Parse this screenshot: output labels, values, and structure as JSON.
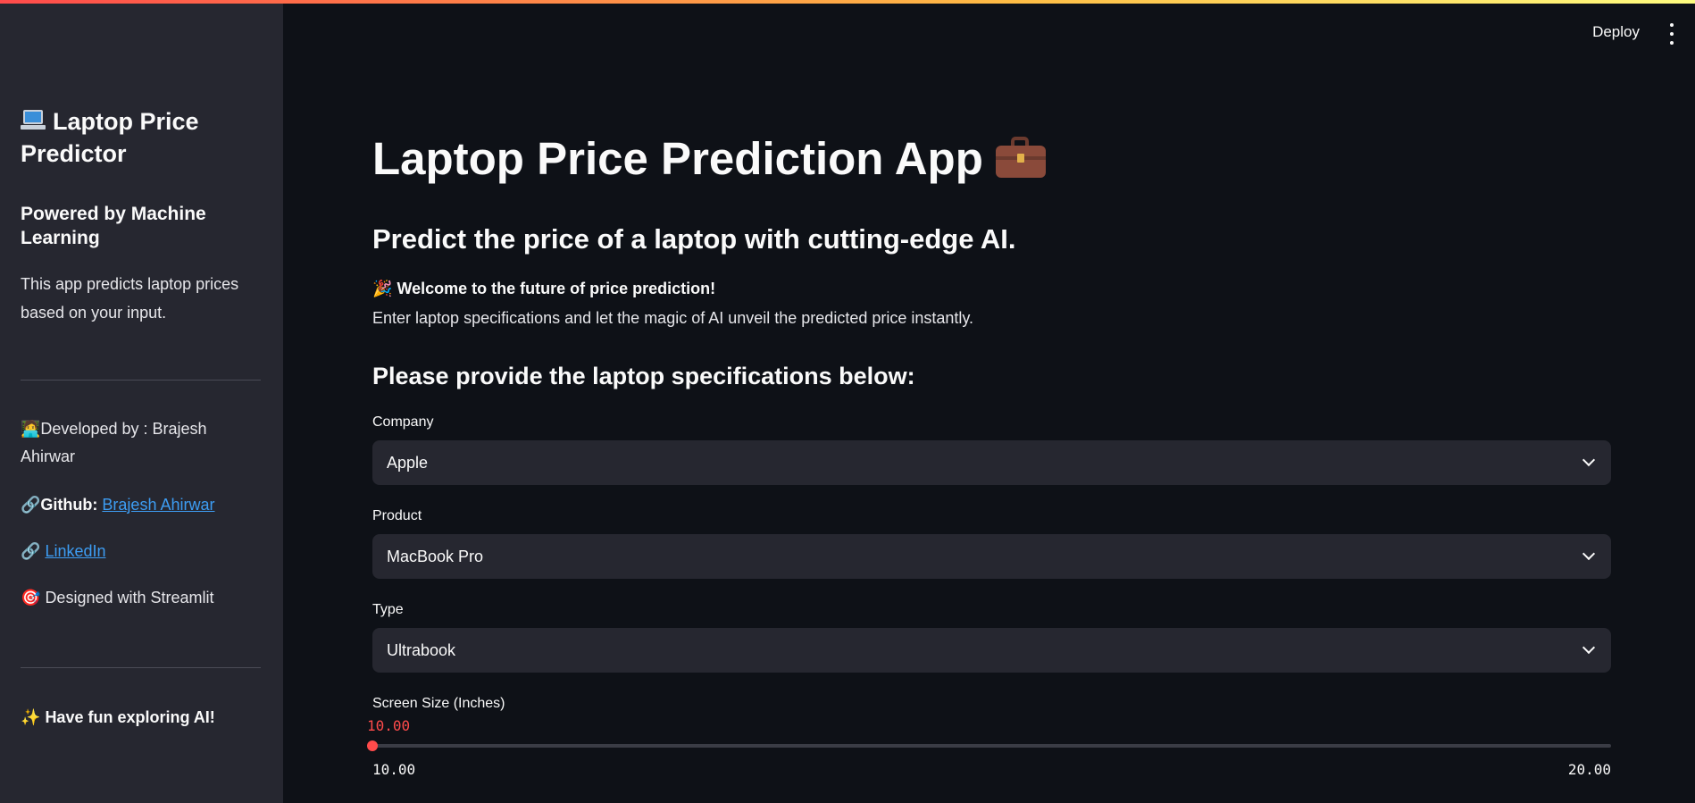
{
  "sidebar": {
    "title": "Laptop Price Predictor",
    "subtitle": "Powered by Machine Learning",
    "description": "This app predicts laptop prices based on your input.",
    "developer_prefix": "🧑‍💻",
    "developer_text": "Developed by : Brajesh Ahirwar",
    "github_prefix": "🔗",
    "github_label": "Github:",
    "github_link": "Brajesh Ahirwar",
    "linkedin_prefix": "🔗",
    "linkedin_link": "LinkedIn",
    "designed_prefix": "🎯",
    "designed_text": "Designed with Streamlit",
    "fun_prefix": "✨",
    "fun_text": "Have fun exploring AI!"
  },
  "header": {
    "deploy_label": "Deploy"
  },
  "main": {
    "title": "Laptop Price Prediction App",
    "subtitle": "Predict the price of a laptop with cutting-edge AI.",
    "welcome_prefix": "🎉",
    "welcome_text": "Welcome to the future of price prediction!",
    "enter_text": "Enter laptop specifications and let the magic of AI unveil the predicted price instantly.",
    "form_heading": "Please provide the laptop specifications below:",
    "fields": {
      "company": {
        "label": "Company",
        "value": "Apple"
      },
      "product": {
        "label": "Product",
        "value": "MacBook Pro"
      },
      "type": {
        "label": "Type",
        "value": "Ultrabook"
      },
      "screen_size": {
        "label": "Screen Size (Inches)",
        "value": "10.00",
        "min": "10.00",
        "max": "20.00",
        "fraction": 0.0
      }
    }
  },
  "colors": {
    "accent": "#ff4b4b",
    "link": "#3d9df3",
    "sidebar_bg": "#262730",
    "main_bg": "#0e1117"
  },
  "icons": [
    "laptop-icon",
    "briefcase-icon",
    "party-popper-icon",
    "technologist-icon",
    "link-icon",
    "target-icon",
    "sparkles-icon",
    "more-vertical-icon",
    "chevron-down-icon"
  ]
}
